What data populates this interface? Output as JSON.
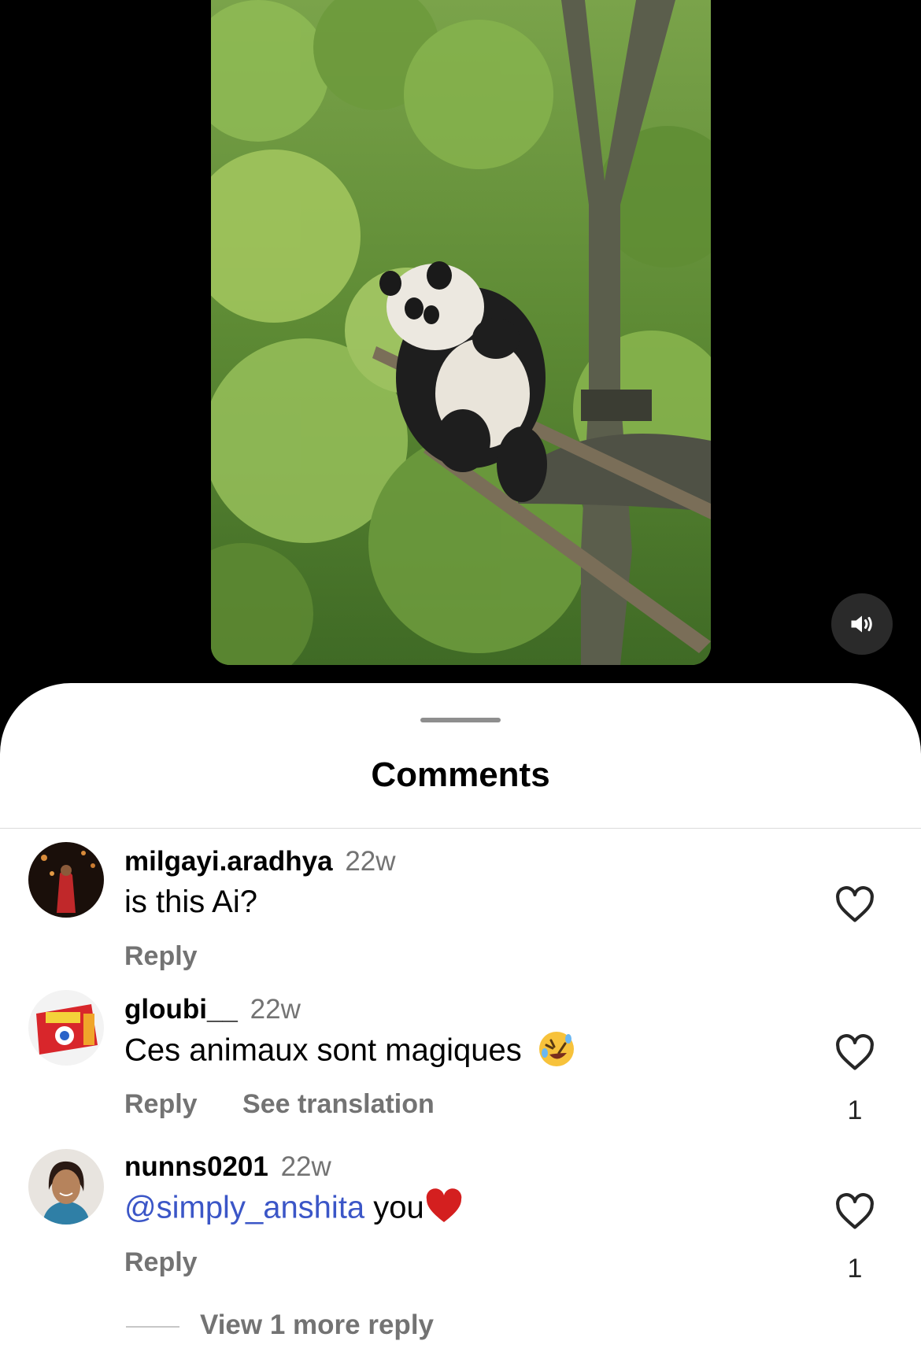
{
  "video": {
    "mute_icon": "speaker-volume-icon"
  },
  "sheet": {
    "title": "Comments"
  },
  "comments": [
    {
      "username": "milgayi.aradhya",
      "time": "22w",
      "text": "is this Ai?",
      "reply_label": "Reply",
      "likes": ""
    },
    {
      "username": "gloubi__",
      "time": "22w",
      "text": "Ces animaux sont magiques",
      "emoji": "rolling-laughing-emoji",
      "reply_label": "Reply",
      "translate_label": "See translation",
      "likes": "1"
    },
    {
      "username": "nunns0201",
      "time": "22w",
      "mention": "@simply_anshita",
      "text": " you",
      "emoji": "red-heart-emoji",
      "reply_label": "Reply",
      "likes": "1"
    }
  ],
  "view_more_replies": "View 1 more reply",
  "colors": {
    "mention": "#3b56c7",
    "secondary_text": "#737373",
    "background": "#ffffff"
  }
}
